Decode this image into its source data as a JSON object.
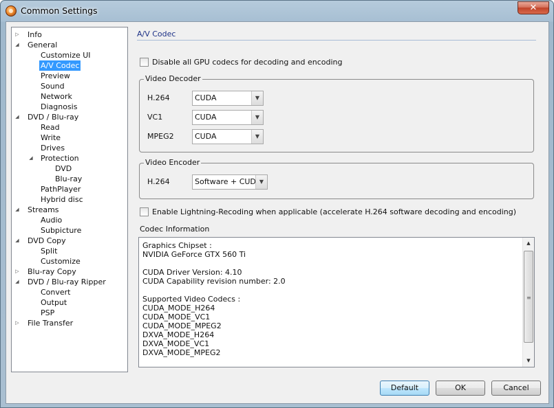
{
  "window": {
    "title": "Common Settings",
    "close_label": "✕"
  },
  "tree": {
    "items": [
      {
        "label": "Info",
        "expander": "▷"
      },
      {
        "label": "General",
        "expander": "◢"
      },
      {
        "label": "Customize UI",
        "expander": ""
      },
      {
        "label": "A/V Codec",
        "expander": ""
      },
      {
        "label": "Preview",
        "expander": ""
      },
      {
        "label": "Sound",
        "expander": ""
      },
      {
        "label": "Network",
        "expander": ""
      },
      {
        "label": "Diagnosis",
        "expander": ""
      },
      {
        "label": "DVD / Blu-ray",
        "expander": "◢"
      },
      {
        "label": "Read",
        "expander": ""
      },
      {
        "label": "Write",
        "expander": ""
      },
      {
        "label": "Drives",
        "expander": ""
      },
      {
        "label": "Protection",
        "expander": "◢"
      },
      {
        "label": "DVD",
        "expander": ""
      },
      {
        "label": "Blu-ray",
        "expander": ""
      },
      {
        "label": "PathPlayer",
        "expander": ""
      },
      {
        "label": "Hybrid disc",
        "expander": ""
      },
      {
        "label": "Streams",
        "expander": "◢"
      },
      {
        "label": "Audio",
        "expander": ""
      },
      {
        "label": "Subpicture",
        "expander": ""
      },
      {
        "label": "DVD Copy",
        "expander": "◢"
      },
      {
        "label": "Split",
        "expander": ""
      },
      {
        "label": "Customize",
        "expander": ""
      },
      {
        "label": "Blu-ray Copy",
        "expander": "▷"
      },
      {
        "label": "DVD / Blu-ray Ripper",
        "expander": "◢"
      },
      {
        "label": "Convert",
        "expander": ""
      },
      {
        "label": "Output",
        "expander": ""
      },
      {
        "label": "PSP",
        "expander": ""
      },
      {
        "label": "File Transfer",
        "expander": "▷"
      }
    ],
    "selected": "A/V Codec"
  },
  "panel": {
    "section_title": "A/V Codec",
    "disable_gpu": {
      "label": "Disable all GPU codecs for decoding and encoding",
      "checked": false
    },
    "video_decoder": {
      "label": "Video Decoder",
      "rows": [
        {
          "label": "H.264",
          "value": "CUDA"
        },
        {
          "label": "VC1",
          "value": "CUDA"
        },
        {
          "label": "MPEG2",
          "value": "CUDA"
        }
      ]
    },
    "video_encoder": {
      "label": "Video Encoder",
      "rows": [
        {
          "label": "H.264",
          "value": "Software + CUDA"
        }
      ]
    },
    "lightning": {
      "label": "Enable Lightning-Recoding when applicable (accelerate H.264 software decoding and encoding)",
      "checked": false
    },
    "codec_info": {
      "label": "Codec Information",
      "text": "Graphics Chipset :\nNVIDIA GeForce GTX 560 Ti\n\nCUDA Driver Version: 4.10\nCUDA Capability revision number: 2.0\n\nSupported Video Codecs :\nCUDA_MODE_H264\nCUDA_MODE_VC1\nCUDA_MODE_MPEG2\nDXVA_MODE_H264\nDXVA_MODE_VC1\nDXVA_MODE_MPEG2\n\nOne AVC support is detected"
    }
  },
  "buttons": {
    "default": "Default",
    "ok": "OK",
    "cancel": "Cancel"
  },
  "scrollbar": {
    "up": "▲",
    "down": "▼",
    "grip": "≡"
  },
  "combo_arrow": "▼"
}
